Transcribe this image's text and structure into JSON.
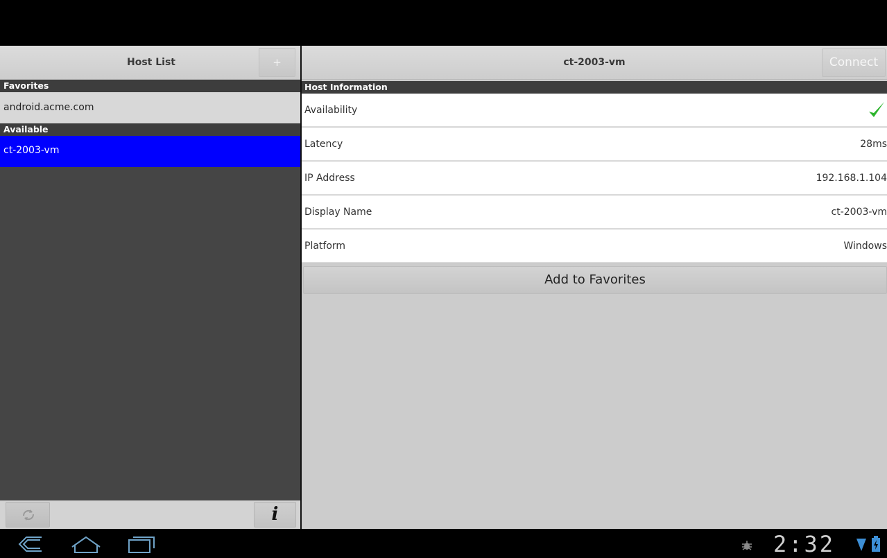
{
  "host_list": {
    "title": "Host List",
    "add_button_label": "+",
    "favorites_header": "Favorites",
    "favorites": [
      "android.acme.com"
    ],
    "available_header": "Available",
    "available": [
      "ct-2003-vm"
    ],
    "selected": "ct-2003-vm",
    "info_button_label": "i",
    "refresh_icon": "refresh-icon"
  },
  "detail": {
    "title": "ct-2003-vm",
    "connect_label": "Connect",
    "section_header": "Host Information",
    "rows": [
      {
        "label": "Availability",
        "value": "",
        "icon": "check-icon"
      },
      {
        "label": "Latency",
        "value": "28ms"
      },
      {
        "label": "IP Address",
        "value": "192.168.1.104"
      },
      {
        "label": "Display Name",
        "value": "ct-2003-vm"
      },
      {
        "label": "Platform",
        "value": "Windows"
      }
    ],
    "add_favorites_label": "Add to Favorites"
  },
  "system_bar": {
    "time": "2:32",
    "icons": [
      "back-icon",
      "home-icon",
      "recent-apps-icon",
      "debug-icon",
      "wifi-icon",
      "battery-icon"
    ]
  },
  "colors": {
    "selected_row": "#0000ff",
    "section_header": "#3d3d3d",
    "check": "#2db52d"
  }
}
